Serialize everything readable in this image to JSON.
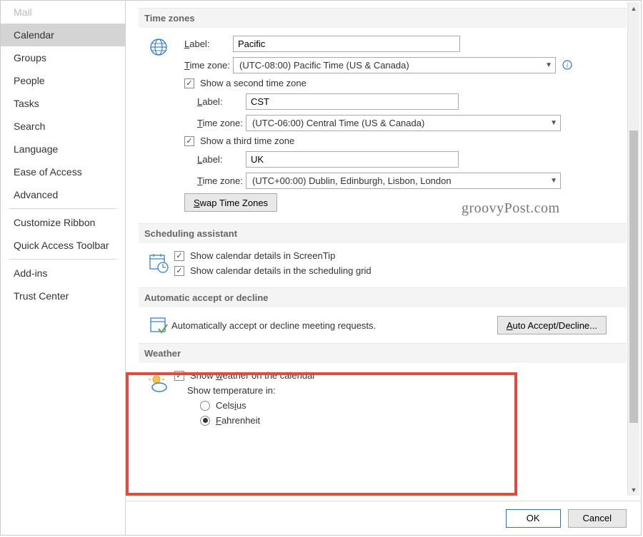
{
  "sidebar": {
    "items": [
      {
        "label": "Mail",
        "class": "dim"
      },
      {
        "label": "Calendar",
        "class": "selected"
      },
      {
        "label": "Groups"
      },
      {
        "label": "People"
      },
      {
        "label": "Tasks"
      },
      {
        "label": "Search"
      },
      {
        "label": "Language"
      },
      {
        "label": "Ease of Access"
      },
      {
        "label": "Advanced"
      },
      {
        "label": "sep"
      },
      {
        "label": "Customize Ribbon"
      },
      {
        "label": "Quick Access Toolbar"
      },
      {
        "label": "sep"
      },
      {
        "label": "Add-ins"
      },
      {
        "label": "Trust Center"
      }
    ]
  },
  "sections": {
    "timezones": {
      "title": "Time zones",
      "tz1": {
        "label_label": "Label:",
        "label_value": "Pacific",
        "tz_label": "Time zone:",
        "tz_label_u": "T",
        "tz_value": "(UTC-08:00) Pacific Time (US & Canada)"
      },
      "show_second": "Show a second time zone",
      "tz2": {
        "label_label": "Label:",
        "label_value": "CST",
        "tz_label": "Time zone:",
        "tz_value": "(UTC-06:00) Central Time (US & Canada)"
      },
      "show_third": "Show a third time zone",
      "tz3": {
        "label_label": "Label:",
        "label_value": "UK",
        "tz_label": "Time zone:",
        "tz_value": "(UTC+00:00) Dublin, Edinburgh, Lisbon, London"
      },
      "swap_btn": "Swap Time Zones"
    },
    "scheduling": {
      "title": "Scheduling assistant",
      "opt1": "Show calendar details in ScreenTip",
      "opt2": "Show calendar details in the scheduling grid"
    },
    "auto": {
      "title": "Automatic accept or decline",
      "text": "Automatically accept or decline meeting requests.",
      "btn": "Auto Accept/Decline..."
    },
    "weather": {
      "title": "Weather",
      "show": "Show weather on the calendar",
      "temp_label": "Show temperature in:",
      "celsius": "Celsius",
      "fahrenheit": "Fahrenheit"
    }
  },
  "buttons": {
    "ok": "OK",
    "cancel": "Cancel"
  },
  "watermark": "groovyPost.com"
}
